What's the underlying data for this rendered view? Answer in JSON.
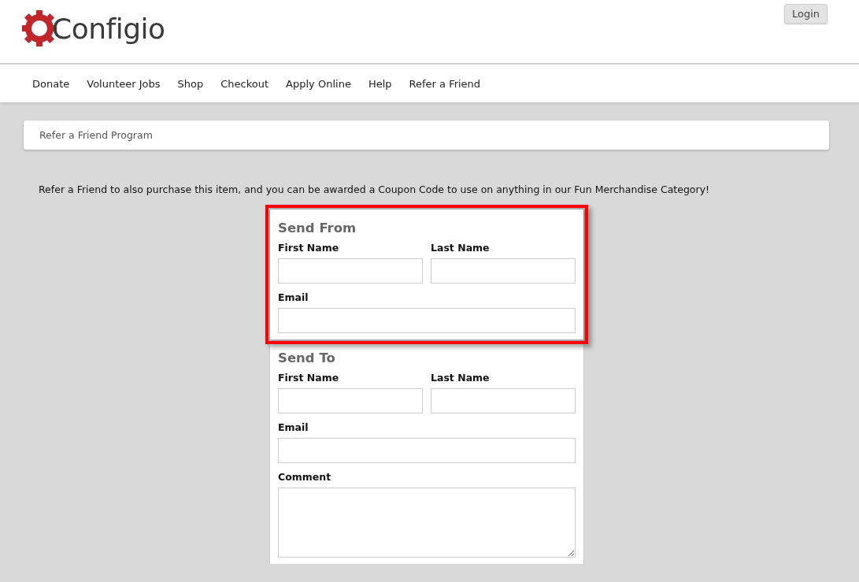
{
  "header": {
    "logo": "Configio",
    "login_button": "Login"
  },
  "nav": [
    "Donate",
    "Volunteer Jobs",
    "Shop",
    "Checkout",
    "Apply Online",
    "Help",
    "Refer a Friend"
  ],
  "breadcrumb": "Refer a Friend Program",
  "intro": "Refer a Friend to also purchase this item, and you can be awarded a Coupon Code to use on anything in our Fun Merchandise Category!",
  "sections": [
    {
      "title": "Send From",
      "highlighted": true,
      "fields": [
        {
          "label": "First Name",
          "kind": "half"
        },
        {
          "label": "Last Name",
          "kind": "half"
        },
        {
          "label": "Email",
          "kind": "full"
        }
      ]
    },
    {
      "title": "Send To",
      "highlighted": false,
      "fields": [
        {
          "label": "First Name",
          "kind": "half"
        },
        {
          "label": "Last Name",
          "kind": "half"
        },
        {
          "label": "Email",
          "kind": "full"
        },
        {
          "label": "Comment",
          "kind": "textarea"
        }
      ]
    }
  ]
}
